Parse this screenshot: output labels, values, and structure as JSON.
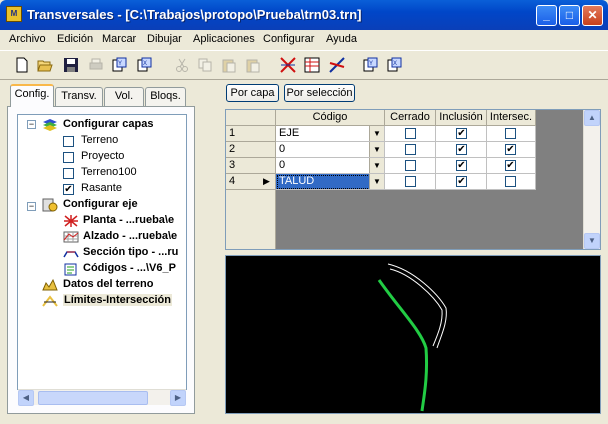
{
  "window": {
    "title": "Transversales - [C:\\Trabajos\\protopo\\Prueba\\trn03.trn]",
    "icon_label": "M",
    "minimize_label": "_",
    "maximize_label": "□",
    "close_label": "✕"
  },
  "menu": [
    "Archivo",
    "Edición",
    "Marcar",
    "Dibujar",
    "Aplicaciones",
    "Configurar",
    "Ayuda"
  ],
  "tabs": [
    "Config.",
    "Transv.",
    "Vol.",
    "Bloqs."
  ],
  "tree": {
    "layers_group": "Configurar capas",
    "layers": [
      {
        "label": "Terreno",
        "checked": false
      },
      {
        "label": "Proyecto",
        "checked": false
      },
      {
        "label": "Terreno100",
        "checked": false
      },
      {
        "label": "Rasante",
        "checked": true
      }
    ],
    "axis_group": "Configurar eje",
    "axis_items": [
      "Planta - ...rueba\\e",
      "Alzado - ...rueba\\e",
      "Sección tipo - ...ru",
      "Códigos - ...\\V6_P"
    ],
    "terrain": "Datos del terreno",
    "limits": "Límites-Intersección",
    "expander_minus": "−"
  },
  "buttons": {
    "by_layer": "Por capa",
    "by_selection": "Por selección"
  },
  "grid": {
    "columns": [
      "Código",
      "Cerrado",
      "Inclusión",
      "Intersec."
    ],
    "rows": [
      {
        "num": "1",
        "code": "EJE",
        "cerrado": false,
        "inclusion": true,
        "intersec": false
      },
      {
        "num": "2",
        "code": "0",
        "cerrado": false,
        "inclusion": true,
        "intersec": true
      },
      {
        "num": "3",
        "code": "0",
        "cerrado": false,
        "inclusion": true,
        "intersec": true
      },
      {
        "num": "4",
        "code": "TALUD",
        "cerrado": false,
        "inclusion": true,
        "intersec": false
      }
    ],
    "current_row_marker": "▶",
    "check_mark": "✔",
    "dropdown_arrow": "▼"
  },
  "scroll": {
    "up": "▲",
    "down": "▼",
    "left": "◀",
    "right": "▶"
  },
  "colors": {
    "accent_line": "#22cc44",
    "canvas_bg": "#000000",
    "selection": "#316ac5"
  }
}
